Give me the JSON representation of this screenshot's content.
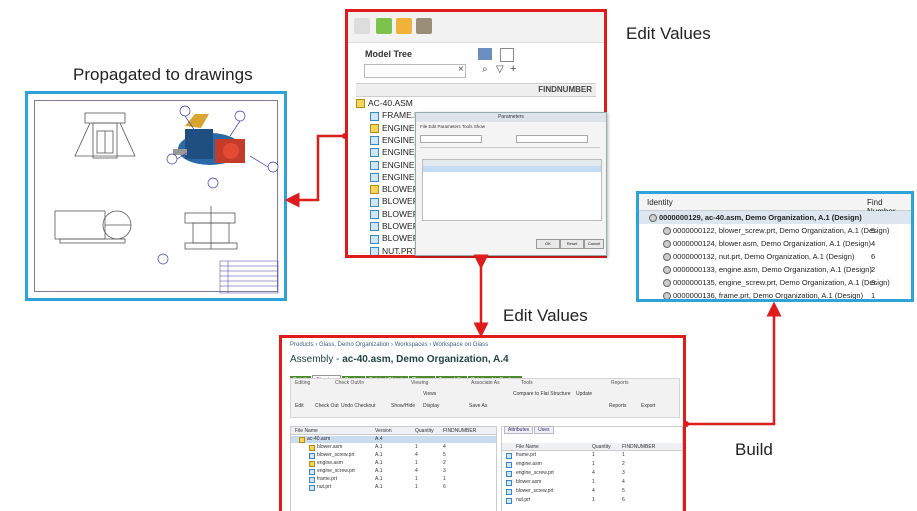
{
  "captions": {
    "propagated": "Propagated to drawings",
    "edit_values_top": "Edit Values",
    "edit_values_bottom": "Edit Values",
    "build": "Build"
  },
  "colors": {
    "pro_engineer_frame": "#e01b1b",
    "windchill_frame": "#2ea3d9",
    "arrow": "#e01b1b"
  },
  "model_tree": {
    "title": "Model Tree",
    "column": "FINDNUMBER",
    "items": [
      {
        "label": "AC-40.ASM",
        "num": "",
        "icon": "assembly-icon",
        "indent": 0
      },
      {
        "label": "FRAME.PRT",
        "num": "1",
        "icon": "part-icon",
        "indent": 1
      },
      {
        "label": "ENGINE.ASM",
        "num": "2",
        "icon": "assembly-icon",
        "indent": 1
      },
      {
        "label": "ENGINE_SCREW.PRT",
        "num": "3",
        "icon": "part-icon",
        "indent": 1
      },
      {
        "label": "ENGINE_",
        "num": "",
        "icon": "part-icon",
        "indent": 1
      },
      {
        "label": "ENGINE_",
        "num": "",
        "icon": "part-icon",
        "indent": 1
      },
      {
        "label": "ENGINE_",
        "num": "",
        "icon": "part-icon",
        "indent": 1
      },
      {
        "label": "BLOWER",
        "num": "",
        "icon": "assembly-icon",
        "indent": 1
      },
      {
        "label": "BLOWER",
        "num": "",
        "icon": "part-icon",
        "indent": 1
      },
      {
        "label": "BLOWER",
        "num": "",
        "icon": "part-icon",
        "indent": 1
      },
      {
        "label": "BLOWER",
        "num": "",
        "icon": "part-icon",
        "indent": 1
      },
      {
        "label": "BLOWER",
        "num": "",
        "icon": "part-icon",
        "indent": 1
      },
      {
        "label": "NUT.PRT",
        "num": "",
        "icon": "part-icon",
        "indent": 1
      }
    ],
    "dialog": {
      "title": "Parameters",
      "menu": "File  Edit  Parameters  Tools  Show",
      "buttons": [
        "OK",
        "Reset",
        "Cancel"
      ]
    }
  },
  "identity_table": {
    "columns": [
      "Identity",
      "Find Number"
    ],
    "rows": [
      {
        "name": "0000000129, ac-40.asm, Demo Organization, A.1 (Design)",
        "num": "",
        "root": true,
        "indent": 0
      },
      {
        "name": "0000000122, blower_screw.prt, Demo Organization, A.1 (Design)",
        "num": "5",
        "root": false,
        "indent": 1
      },
      {
        "name": "0000000124, blower.asm, Demo Organization, A.1 (Design)",
        "num": "4",
        "root": false,
        "indent": 1
      },
      {
        "name": "0000000132, nut.prt, Demo Organization, A.1 (Design)",
        "num": "6",
        "root": false,
        "indent": 1
      },
      {
        "name": "0000000133, engine.asm, Demo Organization, A.1 (Design)",
        "num": "2",
        "root": false,
        "indent": 1
      },
      {
        "name": "0000000135, engine_screw.prt, Demo Organization, A.1 (Design)",
        "num": "3",
        "root": false,
        "indent": 1
      },
      {
        "name": "0000000136, frame.prt, Demo Organization, A.1 (Design)",
        "num": "1",
        "root": false,
        "indent": 1
      }
    ]
  },
  "structure": {
    "breadcrumb": "Products › Glass, Demo Organization › Workspaces › Workspace on Glass",
    "title_prefix": "Assembly - ",
    "title": "ac-40.asm, Demo Organization, A.4",
    "tabs": [
      "Details",
      "Structure",
      "Content",
      "Related Objects",
      "Changes",
      "Traceability",
      "Relationship Explorer"
    ],
    "ribbon": {
      "groups": [
        "Editing",
        "Check Out/In",
        "Viewing",
        "Associate As",
        "Tools",
        "Reports"
      ],
      "buttons": [
        "Edit",
        "Check Out",
        "Undo Checkout",
        "Show/Hide",
        "Views",
        "Display",
        "Save As",
        "Compare to Flat Structure",
        "Update",
        "Reports",
        "Export"
      ]
    },
    "left_table": {
      "columns": [
        "File Name",
        "Version",
        "Quantity",
        "FINDNUMBER"
      ],
      "rows": [
        {
          "name": "ac-40.asm",
          "version": "A.4",
          "qty": "",
          "find": "",
          "sel": true,
          "asm": true
        },
        {
          "name": "blower.asm",
          "version": "A.1",
          "qty": "1",
          "find": "4",
          "sel": false,
          "asm": true
        },
        {
          "name": "blower_screw.prt",
          "version": "A.1",
          "qty": "4",
          "find": "5",
          "sel": false,
          "asm": false
        },
        {
          "name": "engine.asm",
          "version": "A.1",
          "qty": "1",
          "find": "2",
          "sel": false,
          "asm": true
        },
        {
          "name": "engine_screw.prt",
          "version": "A.1",
          "qty": "4",
          "find": "3",
          "sel": false,
          "asm": false
        },
        {
          "name": "frame.prt",
          "version": "A.1",
          "qty": "1",
          "find": "1",
          "sel": false,
          "asm": false
        },
        {
          "name": "nut.prt",
          "version": "A.1",
          "qty": "1",
          "find": "6",
          "sel": false,
          "asm": false
        }
      ]
    },
    "right_table": {
      "tabs": [
        "Attributes",
        "Uses"
      ],
      "columns": [
        "File Name",
        "Quantity",
        "FINDNUMBER"
      ],
      "rows": [
        {
          "name": "frame.prt",
          "qty": "1",
          "find": "1"
        },
        {
          "name": "engine.asm",
          "qty": "1",
          "find": "2"
        },
        {
          "name": "engine_screw.prt",
          "qty": "4",
          "find": "3"
        },
        {
          "name": "blower.asm",
          "qty": "1",
          "find": "4"
        },
        {
          "name": "blower_screw.prt",
          "qty": "4",
          "find": "5"
        },
        {
          "name": "nut.prt",
          "qty": "1",
          "find": "6"
        }
      ]
    }
  }
}
